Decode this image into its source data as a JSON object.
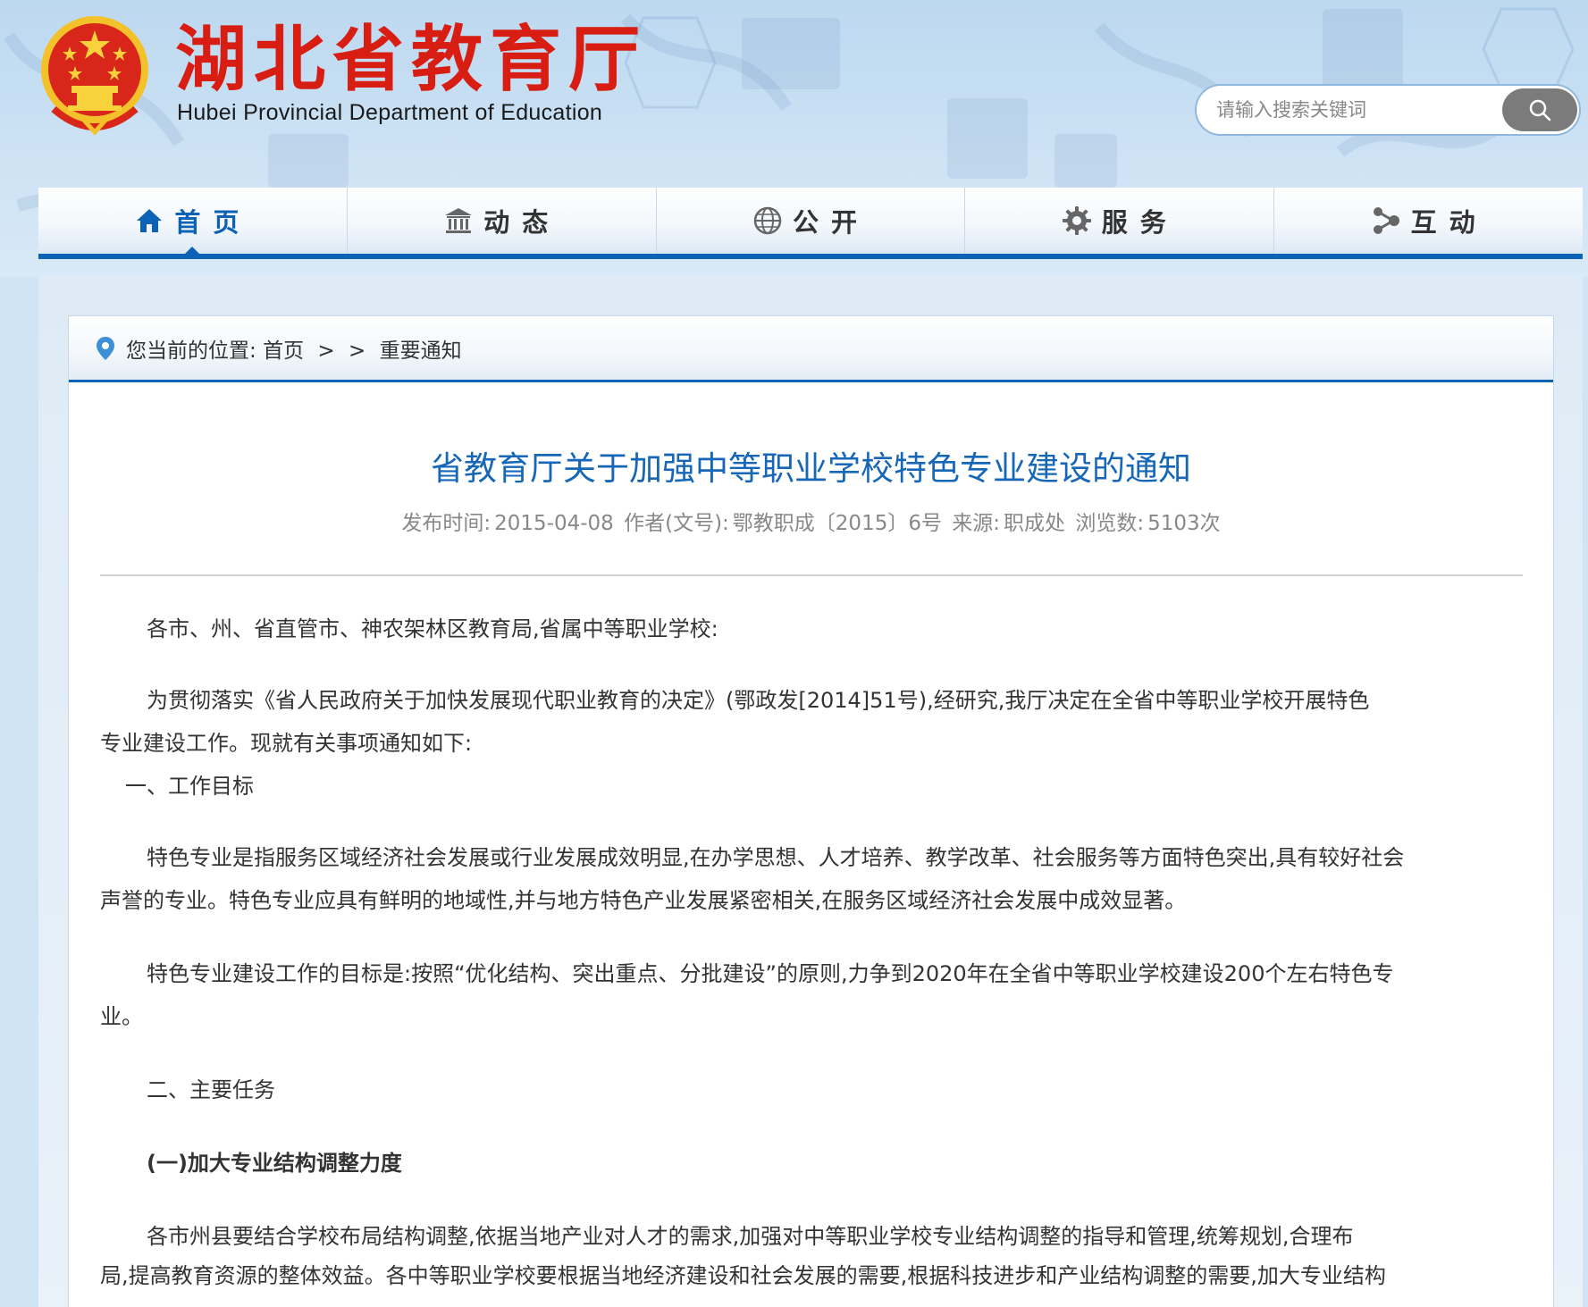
{
  "header": {
    "title": "湖北省教育厅",
    "subtitle": "Hubei Provincial Department of Education",
    "search_placeholder": "请输入搜索关键词",
    "emblem_icon": "national-emblem-icon"
  },
  "nav": {
    "items": [
      {
        "label": "首页",
        "icon": "home-icon",
        "active": true
      },
      {
        "label": "动态",
        "icon": "building-icon",
        "active": false
      },
      {
        "label": "公开",
        "icon": "globe-icon",
        "active": false
      },
      {
        "label": "服务",
        "icon": "gear-icon",
        "active": false
      },
      {
        "label": "互动",
        "icon": "share-icon",
        "active": false
      }
    ]
  },
  "breadcrumb": {
    "prefix": "您当前的位置:",
    "home": "首页",
    "sep1": ">",
    "sep2": ">",
    "current": "重要通知"
  },
  "article": {
    "title": "省教育厅关于加强中等职业学校特色专业建设的通知",
    "meta": {
      "publish_label": "发布时间:",
      "publish_date": "2015-04-08",
      "author_label": "作者(文号):",
      "author": "鄂教职成〔2015〕6号",
      "source_label": "来源:",
      "source": "职成处",
      "views_label": "浏览数:",
      "views": "5103次"
    },
    "paragraphs": [
      "各市、州、省直管市、神农架林区教育局,省属中等职业学校:",
      "为贯彻落实《省人民政府关于加快发展现代职业教育的决定》(鄂政发[2014]51号),经研究,我厅决定在全省中等职业学校开展特色",
      "专业建设工作。现就有关事项通知如下:",
      "一、工作目标",
      "特色专业是指服务区域经济社会发展或行业发展成效明显,在办学思想、人才培养、教学改革、社会服务等方面特色突出,具有较好社会",
      "声誉的专业。特色专业应具有鲜明的地域性,并与地方特色产业发展紧密相关,在服务区域经济社会发展中成效显著。",
      "特色专业建设工作的目标是:按照“优化结构、突出重点、分批建设”的原则,力争到2020年在全省中等职业学校建设200个左右特色专",
      "业。",
      "二、主要任务",
      "(一)加大专业结构调整力度",
      "各市州县要结合学校布局结构调整,依据当地产业对人才的需求,加强对中等职业学校专业结构调整的指导和管理,统筹规划,合理布",
      "局,提高教育资源的整体效益。各中等职业学校要根据当地经济建设和社会发展的需要,根据科技进步和产业结构调整的需要,加大专业结构"
    ]
  },
  "colors": {
    "accent": "#0c62b4",
    "title_red": "#d81e12",
    "article_title": "#1667b7"
  }
}
